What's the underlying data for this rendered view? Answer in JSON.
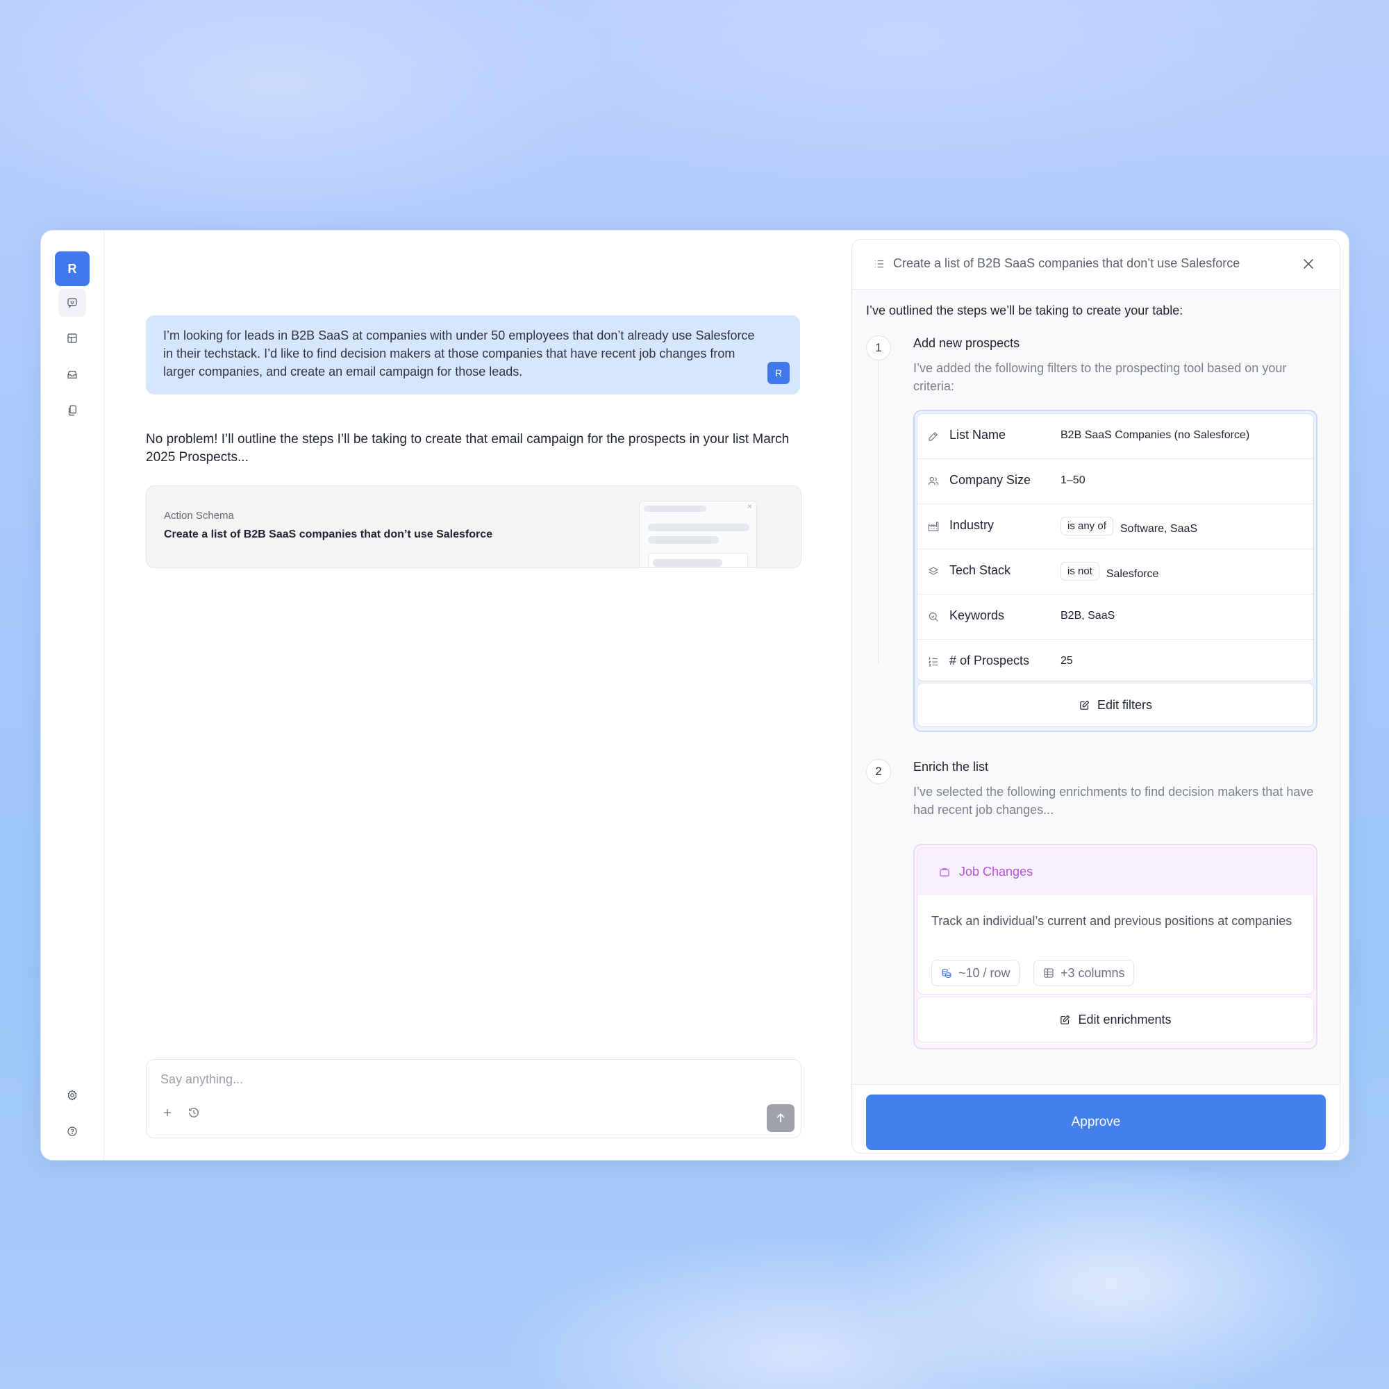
{
  "rail": {
    "avatar_letter": "R",
    "nav": [
      "chat-icon",
      "table-icon",
      "inbox-icon",
      "files-icon"
    ],
    "bottom": [
      "settings-icon",
      "help-icon"
    ]
  },
  "chat": {
    "user_message": "I’m looking for leads in B2B SaaS at companies with under 50 employees that don’t already use Salesforce in their techstack. I’d like to find decision makers at those companies that have recent job changes from larger companies, and create an email campaign for those leads.",
    "user_avatar": "R",
    "assistant_message": "No problem! I’ll outline the steps I’ll be taking to create that email campaign for the prospects in your list March 2025 Prospects...",
    "schema_card": {
      "label": "Action Schema",
      "title": "Create a list of B2B SaaS companies that don’t use Salesforce"
    },
    "composer": {
      "placeholder": "Say anything..."
    }
  },
  "panel": {
    "title": "Create a list of B2B SaaS companies that don’t use Salesforce",
    "intro": "I’ve outlined the steps we’ll be taking to create your table:",
    "step1": {
      "number": "1",
      "title": "Add new prospects",
      "description": "I’ve added the following filters to the prospecting tool based on your criteria:",
      "filters": [
        {
          "icon": "pencil-icon",
          "label": "List Name",
          "operator": "",
          "value": "B2B SaaS Companies (no Salesforce)"
        },
        {
          "icon": "users-icon",
          "label": "Company Size",
          "operator": "",
          "value": "1–50"
        },
        {
          "icon": "factory-icon",
          "label": "Industry",
          "operator": "is any of",
          "value": "Software, SaaS"
        },
        {
          "icon": "layers-icon",
          "label": "Tech Stack",
          "operator": "is not",
          "value": "Salesforce"
        },
        {
          "icon": "search-icon",
          "label": "Keywords",
          "operator": "",
          "value": "B2B, SaaS"
        },
        {
          "icon": "list-ordered-icon",
          "label": "# of Prospects",
          "operator": "",
          "value": "25"
        }
      ],
      "edit_label": "Edit filters"
    },
    "step2": {
      "number": "2",
      "title": "Enrich the list",
      "description": "I’ve selected the following enrichments to find decision makers that have had recent job changes...",
      "enrichment": {
        "name": "Job Changes",
        "description": "Track an individual’s current and previous positions at companies",
        "cost": "~10 / row",
        "columns": "+3 columns"
      },
      "edit_label": "Edit enrichments"
    },
    "approve_label": "Approve"
  },
  "colors": {
    "accent": "#4480ec",
    "user_bubble": "#d7e6fd",
    "enrichment_accent": "#b453d9"
  }
}
